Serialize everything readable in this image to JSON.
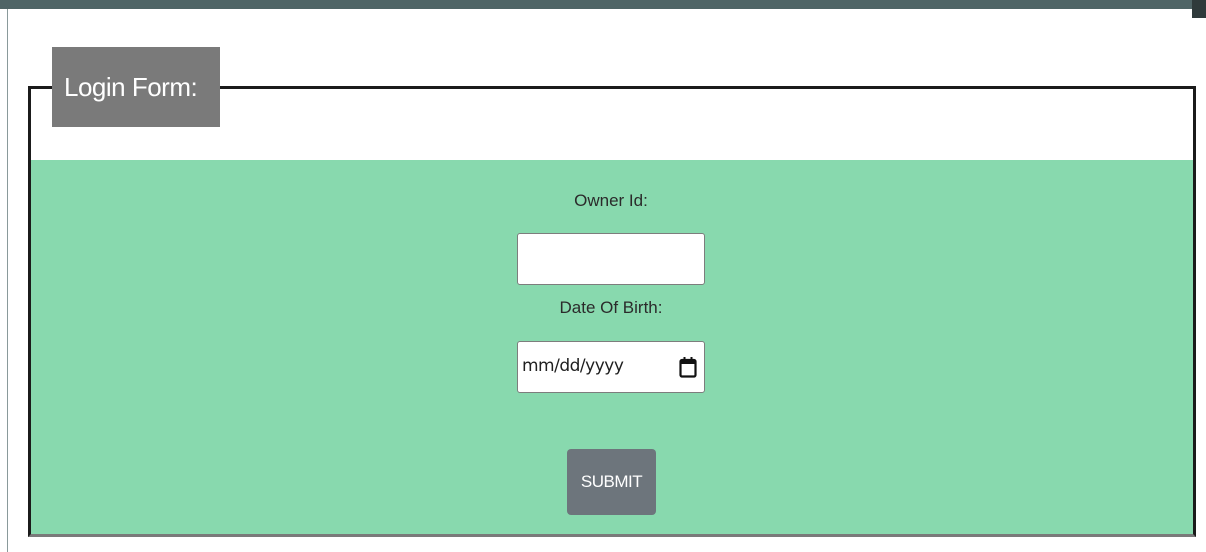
{
  "form": {
    "legend": "Login Form:",
    "owner_id_label": "Owner Id:",
    "owner_id_value": "",
    "dob_label": "Date Of Birth:",
    "dob_placeholder": "mm/dd/yyyy",
    "submit_label": "SUBMIT"
  },
  "colors": {
    "panel_background": "#88d9ae",
    "legend_background": "#7a7a7a",
    "button_background": "#6d757c",
    "top_bar": "#4f6466"
  },
  "icons": {
    "date_picker": "calendar-icon"
  }
}
